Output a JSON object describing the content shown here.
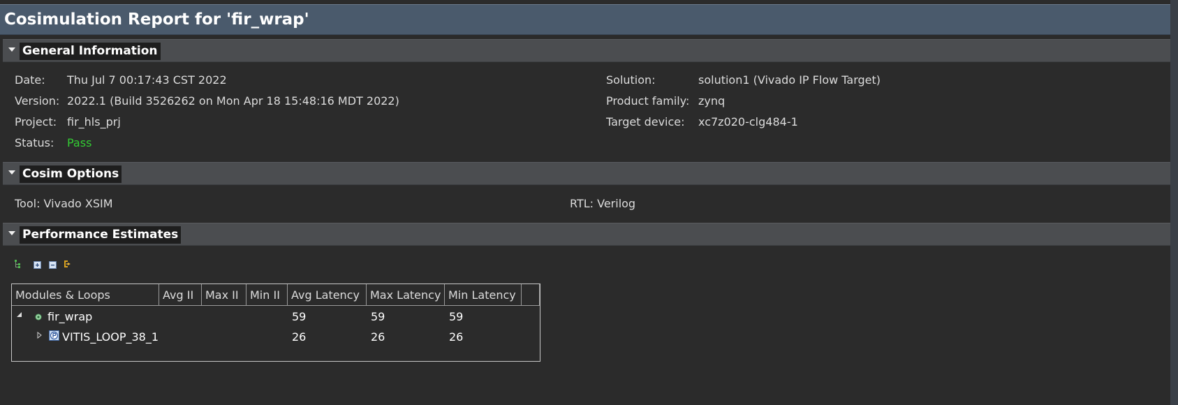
{
  "report": {
    "title": "Cosimulation Report for 'fir_wrap'"
  },
  "general": {
    "header": "General Information",
    "date_label": "Date:",
    "date_value": "Thu Jul 7 00:17:43 CST 2022",
    "version_label": "Version:",
    "version_value": "2022.1 (Build 3526262 on Mon Apr 18 15:48:16 MDT 2022)",
    "project_label": "Project:",
    "project_value": "fir_hls_prj",
    "status_label": "Status:",
    "status_value": "Pass",
    "solution_label": "Solution:",
    "solution_value": "solution1 (Vivado IP Flow Target)",
    "family_label": "Product family:",
    "family_value": "zynq",
    "device_label": "Target device:",
    "device_value": "xc7z020-clg484-1"
  },
  "cosim": {
    "header": "Cosim Options",
    "tool": "Tool: Vivado XSIM",
    "rtl": "RTL: Verilog"
  },
  "perf": {
    "header": "Performance Estimates",
    "columns": [
      "Modules & Loops",
      "Avg II",
      "Max II",
      "Min II",
      "Avg Latency",
      "Max Latency",
      "Min Latency"
    ],
    "rows": [
      {
        "name": "fir_wrap",
        "avg_ii": "",
        "max_ii": "",
        "min_ii": "",
        "avg_lat": "59",
        "max_lat": "59",
        "min_lat": "59"
      },
      {
        "name": "VITIS_LOOP_38_1",
        "avg_ii": "",
        "max_ii": "",
        "min_ii": "",
        "avg_lat": "26",
        "max_lat": "26",
        "min_lat": "26"
      }
    ]
  },
  "icons": {
    "toolbar": [
      "tree-icon",
      "expand-all-icon",
      "collapse-all-icon",
      "export-icon"
    ],
    "module_icon": "module-circle-icon",
    "loop_icon": "pipeline-loop-icon"
  },
  "colors": {
    "pass": "#33cc33",
    "title_bar": "#4a5a6c",
    "section_header": "#4b4d50"
  }
}
